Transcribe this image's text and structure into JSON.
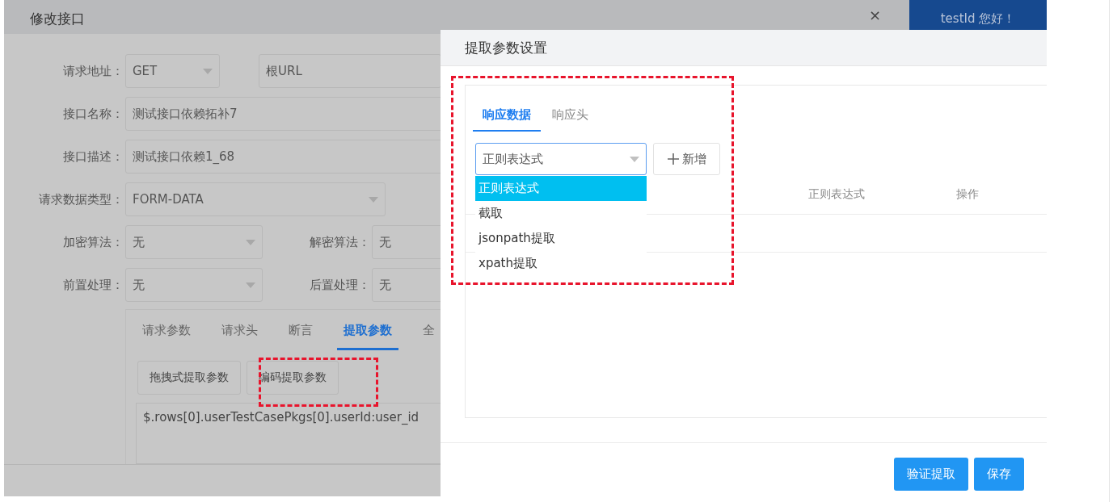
{
  "base_dialog": {
    "title": "修改接口",
    "close": "×",
    "user_menu": {
      "label": "testId 您好！"
    },
    "form_rows": [
      {
        "items": [
          {
            "label": "请求地址：",
            "value": "GET",
            "kind": "select"
          },
          {
            "value": "根URL",
            "kind": "input"
          }
        ]
      },
      {
        "items": [
          {
            "label": "接口名称：",
            "value": "测试接口依赖拓补7",
            "kind": "input"
          }
        ]
      },
      {
        "items": [
          {
            "label": "接口描述：",
            "value": "测试接口依赖1_68",
            "kind": "input"
          }
        ]
      },
      {
        "items": [
          {
            "label": "请求数据类型：",
            "value": "FORM-DATA",
            "kind": "select"
          }
        ]
      },
      {
        "items": [
          {
            "label": "加密算法：",
            "value": "无",
            "kind": "select"
          },
          {
            "label": "解密算法：",
            "value": "无",
            "kind": "input"
          }
        ]
      },
      {
        "items": [
          {
            "label": "前置处理：",
            "value": "无",
            "kind": "select"
          },
          {
            "label": "后置处理：",
            "value": "无",
            "kind": "input"
          }
        ]
      }
    ],
    "tabs": [
      {
        "label": "请求参数",
        "selected": false
      },
      {
        "label": "请求头",
        "selected": false
      },
      {
        "label": "断言",
        "selected": false
      },
      {
        "label": "提取参数",
        "selected": true
      },
      {
        "label": "全",
        "selected": false
      }
    ],
    "extract_buttons": [
      "拖拽式提取参数",
      "编码提取参数"
    ],
    "code": "$.rows[0].userTestCasePkgs[0].userId:user_id"
  },
  "modal": {
    "title": "提取参数设置",
    "tabs": [
      {
        "label": "响应数据",
        "selected": true
      },
      {
        "label": "响应头",
        "selected": false
      }
    ],
    "select": {
      "value": "正则表达式"
    },
    "add_button": "新增",
    "dropdown": [
      {
        "label": "正则表达式",
        "selected": true
      },
      {
        "label": "截取",
        "selected": false
      },
      {
        "label": "jsonpath提取",
        "selected": false
      },
      {
        "label": "xpath提取",
        "selected": false
      }
    ],
    "table": {
      "columns": [
        "正则表达式",
        "操作"
      ]
    },
    "buttons": [
      "验证提取",
      "保存"
    ]
  }
}
